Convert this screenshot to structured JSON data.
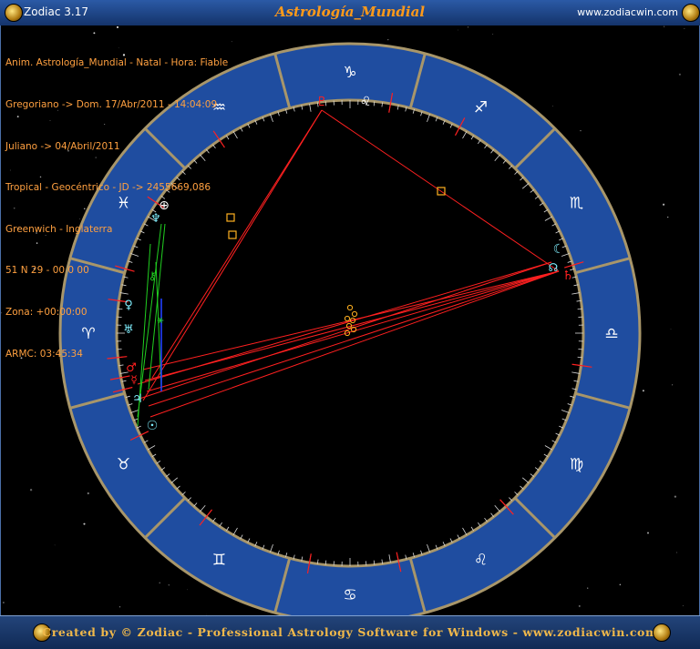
{
  "window": {
    "app_title": "Zodiac 3.17",
    "chart_title": "Astrología_Mundial",
    "website": "www.zodiacwin.com"
  },
  "info_lines": [
    "Anim. Astrología_Mundial - Natal - Hora: Fiable",
    "Gregoriano -> Dom. 17/Abr/2011 - 14:04:09",
    "Juliano -> 04/Abril/2011",
    "Tropical - Geocéntrico - JD -> 2455669,086",
    "Greenwich - Inglaterra",
    "51 N 29 - 00 0 00",
    "Zona: +00:00:00",
    "ARMC: 03:45:34"
  ],
  "footer": {
    "text": "Created by © Zodiac - Professional Astrology Software for Windows - www.zodiacwin.com"
  },
  "colors": {
    "wheel_band": "#1f4da0",
    "wheel_border": "#a8966a",
    "aspect_red": "#ff2020",
    "aspect_green": "#20d020",
    "aspect_blue": "#2040ff",
    "glyph_white": "#ffffff",
    "planet_cyan": "#80f0ff",
    "planet_orange": "#ffb020",
    "info_text": "#ffa040",
    "footer_text": "#f0b84a"
  },
  "zodiac_ring": [
    {
      "glyph": "♑",
      "name": "capricorn-sign"
    },
    {
      "glyph": "♐",
      "name": "sagittarius-sign"
    },
    {
      "glyph": "♏",
      "name": "scorpio-sign"
    },
    {
      "glyph": "♎",
      "name": "libra-sign"
    },
    {
      "glyph": "♍",
      "name": "virgo-sign"
    },
    {
      "glyph": "♌",
      "name": "leo-sign"
    },
    {
      "glyph": "♋",
      "name": "cancer-sign"
    },
    {
      "glyph": "♊",
      "name": "gemini-sign"
    },
    {
      "glyph": "♉",
      "name": "taurus-sign"
    },
    {
      "glyph": "♈",
      "name": "aries-sign"
    },
    {
      "glyph": "♓",
      "name": "pisces-sign"
    },
    {
      "glyph": "♒",
      "name": "aquarius-sign"
    }
  ],
  "planets": [
    {
      "glyph": "♇",
      "name": "pluto-glyph",
      "color": "#ff2020"
    },
    {
      "glyph": "♌",
      "name": "leo-inner-glyph",
      "color": "#ffffff"
    },
    {
      "glyph": "☾",
      "name": "moon-glyph",
      "color": "#80f0ff"
    },
    {
      "glyph": "☊",
      "name": "node-glyph",
      "color": "#80f0ff"
    },
    {
      "glyph": "♄",
      "name": "saturn-glyph",
      "color": "#ff2020"
    },
    {
      "glyph": "⊕",
      "name": "earth-glyph",
      "color": "#ffffff"
    },
    {
      "glyph": "♆",
      "name": "neptune-glyph",
      "color": "#80f0ff"
    },
    {
      "glyph": "♀",
      "name": "venus-glyph",
      "color": "#80f0ff"
    },
    {
      "glyph": "♅",
      "name": "uranus-glyph",
      "color": "#80f0ff"
    },
    {
      "glyph": "♂",
      "name": "mars-glyph",
      "color": "#ff2020"
    },
    {
      "glyph": "♃",
      "name": "jupiter-glyph",
      "color": "#80f0ff"
    },
    {
      "glyph": "☉",
      "name": "sun-glyph",
      "color": "#80f0ff"
    },
    {
      "glyph": "⚷",
      "name": "chiron-glyph",
      "color": "#20d020"
    },
    {
      "glyph": "⚹",
      "name": "sextile-glyph",
      "color": "#20d020"
    },
    {
      "glyph": "☿",
      "name": "mercury-glyph",
      "color": "#ff2020"
    }
  ]
}
